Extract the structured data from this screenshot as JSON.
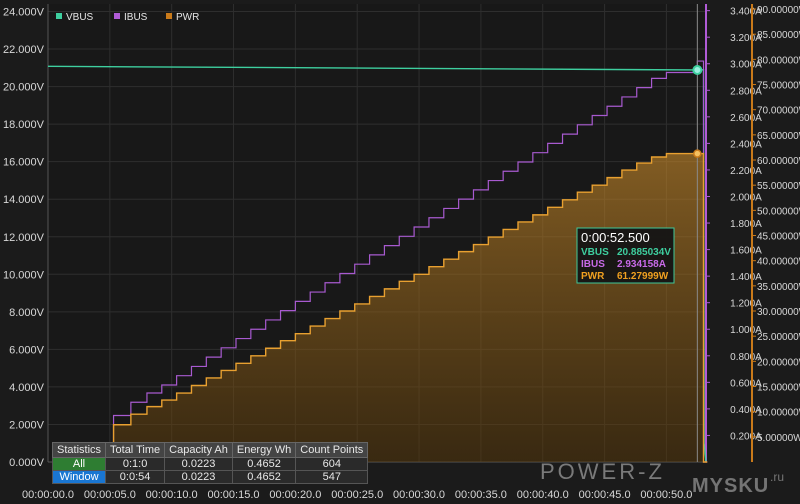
{
  "chart_data": {
    "type": "line",
    "title": "",
    "legend": {
      "placement": "top-left",
      "items": [
        {
          "name": "VBUS",
          "color": "#3ecf9f"
        },
        {
          "name": "IBUS",
          "color": "#b05bd6"
        },
        {
          "name": "PWR",
          "color": "#c97a1a"
        }
      ]
    },
    "grid": true,
    "x_axis": {
      "range": [
        0,
        53.2
      ],
      "ticks": [
        0,
        5,
        10,
        15,
        20,
        25,
        30,
        35,
        40,
        45,
        50
      ],
      "tick_labels": [
        "00:00:00.0",
        "00:00:05.0",
        "00:00:10.0",
        "00:00:15.0",
        "00:00:20.0",
        "00:00:25.0",
        "00:00:30.0",
        "00:00:35.0",
        "00:00:40.0",
        "00:00:45.0",
        "00:00:50.0"
      ]
    },
    "y_axis_left": {
      "name": "VBUS",
      "range": [
        0,
        24.4
      ],
      "ticks": [
        0,
        2,
        4,
        6,
        8,
        10,
        12,
        14,
        16,
        18,
        20,
        22,
        24
      ],
      "tick_labels": [
        "0.000V",
        "2.000V",
        "4.000V",
        "6.000V",
        "8.000V",
        "10.000V",
        "12.000V",
        "14.000V",
        "16.000V",
        "18.000V",
        "20.000V",
        "22.000V",
        "24.000V"
      ]
    },
    "y_axis_right1": {
      "name": "IBUS",
      "range": [
        0,
        3.45
      ],
      "ticks": [
        0.2,
        0.4,
        0.6,
        0.8,
        1.0,
        1.2,
        1.4,
        1.6,
        1.8,
        2.0,
        2.2,
        2.4,
        2.6,
        2.8,
        3.0,
        3.2,
        3.4
      ],
      "tick_labels": [
        "0.200A",
        "0.400A",
        "0.600A",
        "0.800A",
        "1.000A",
        "1.200A",
        "1.400A",
        "1.600A",
        "1.800A",
        "2.000A",
        "2.200A",
        "2.400A",
        "2.600A",
        "2.800A",
        "3.000A",
        "3.200A",
        "3.400A"
      ]
    },
    "y_axis_right2": {
      "name": "PWR",
      "range": [
        0,
        91
      ],
      "ticks": [
        5,
        10,
        15,
        20,
        25,
        30,
        35,
        40,
        45,
        50,
        55,
        60,
        65,
        70,
        75,
        80,
        85,
        90
      ],
      "tick_labels": [
        "5.00000W",
        "10.00000W",
        "15.00000W",
        "20.00000W",
        "25.00000W",
        "30.00000W",
        "35.00000W",
        "40.00000W",
        "45.00000W",
        "50.00000W",
        "55.00000W",
        "60.00000W",
        "65.00000W",
        "70.00000W",
        "75.00000W",
        "80.00000W",
        "85.00000W",
        "90.00000W"
      ]
    },
    "series": [
      {
        "name": "VBUS",
        "axis": "left",
        "x": [
          0,
          52.5,
          53.0,
          53.05,
          53.2
        ],
        "values": [
          21.08,
          20.885,
          20.9,
          1.0,
          0.0
        ]
      },
      {
        "name": "IBUS",
        "axis": "right1",
        "x": [
          3.8,
          5.3,
          6.7,
          8.0,
          9.2,
          10.4,
          11.6,
          12.8,
          14.0,
          15.2,
          16.4,
          17.6,
          18.8,
          20.0,
          21.2,
          22.4,
          23.6,
          24.8,
          26.0,
          27.2,
          28.4,
          29.6,
          30.8,
          32.0,
          33.2,
          34.4,
          35.6,
          36.8,
          38.0,
          39.2,
          40.4,
          41.6,
          42.8,
          44.0,
          45.2,
          46.4,
          47.6,
          48.8,
          50.0,
          51.4,
          52.5,
          53.0,
          53.3
        ],
        "values": [
          0.05,
          0.35,
          0.45,
          0.52,
          0.58,
          0.65,
          0.72,
          0.79,
          0.86,
          0.93,
          1.0,
          1.07,
          1.14,
          1.21,
          1.28,
          1.35,
          1.42,
          1.49,
          1.56,
          1.63,
          1.7,
          1.77,
          1.84,
          1.91,
          1.98,
          2.05,
          2.12,
          2.19,
          2.26,
          2.33,
          2.4,
          2.47,
          2.54,
          2.61,
          2.68,
          2.75,
          2.82,
          2.89,
          2.934,
          2.934,
          3.02,
          0.0,
          0.0
        ]
      },
      {
        "name": "PWR",
        "axis": "right2",
        "x": [
          3.8,
          5.3,
          6.7,
          8.0,
          9.2,
          10.4,
          11.6,
          12.8,
          14.0,
          15.2,
          16.4,
          17.6,
          18.8,
          20.0,
          21.2,
          22.4,
          23.6,
          24.8,
          26.0,
          27.2,
          28.4,
          29.6,
          30.8,
          32.0,
          33.2,
          34.4,
          35.6,
          36.8,
          38.0,
          39.2,
          40.4,
          41.6,
          42.8,
          44.0,
          45.2,
          46.4,
          47.6,
          48.8,
          50.0,
          51.4,
          52.5,
          53.0,
          53.3
        ],
        "values": [
          1.0,
          7.4,
          9.5,
          11.0,
          12.3,
          13.7,
          15.2,
          16.7,
          18.2,
          19.6,
          21.1,
          22.6,
          24.1,
          25.5,
          27.0,
          28.5,
          30.0,
          31.4,
          32.9,
          34.4,
          35.9,
          37.3,
          38.8,
          40.3,
          41.8,
          43.2,
          44.7,
          46.2,
          47.7,
          49.1,
          50.6,
          52.1,
          53.6,
          55.0,
          56.5,
          58.0,
          59.4,
          60.6,
          61.28,
          61.28,
          61.28,
          0.0,
          0.0
        ]
      }
    ],
    "cursor": {
      "x": 52.5,
      "time_label": "0:00:52.500",
      "readouts": [
        {
          "name": "VBUS",
          "value": "20.885034V",
          "color": "#3ecf9f"
        },
        {
          "name": "IBUS",
          "value": "2.934158A",
          "color": "#c86ae8"
        },
        {
          "name": "PWR",
          "value": "61.27999W",
          "color": "#f0a020"
        }
      ]
    }
  },
  "stats": {
    "headers": [
      "Statistics",
      "Total Time",
      "Capacity Ah",
      "Energy Wh",
      "Count Points"
    ],
    "rows": [
      {
        "label": "All",
        "total_time": "0:1:0",
        "capacity": "0.0223",
        "energy": "0.4652",
        "count": "604"
      },
      {
        "label": "Window",
        "total_time": "0:0:54",
        "capacity": "0.0223",
        "energy": "0.4652",
        "count": "547"
      }
    ]
  },
  "watermark": {
    "brand": "POWER-Z",
    "site": "MYSKU",
    "suffix": ".ru"
  }
}
